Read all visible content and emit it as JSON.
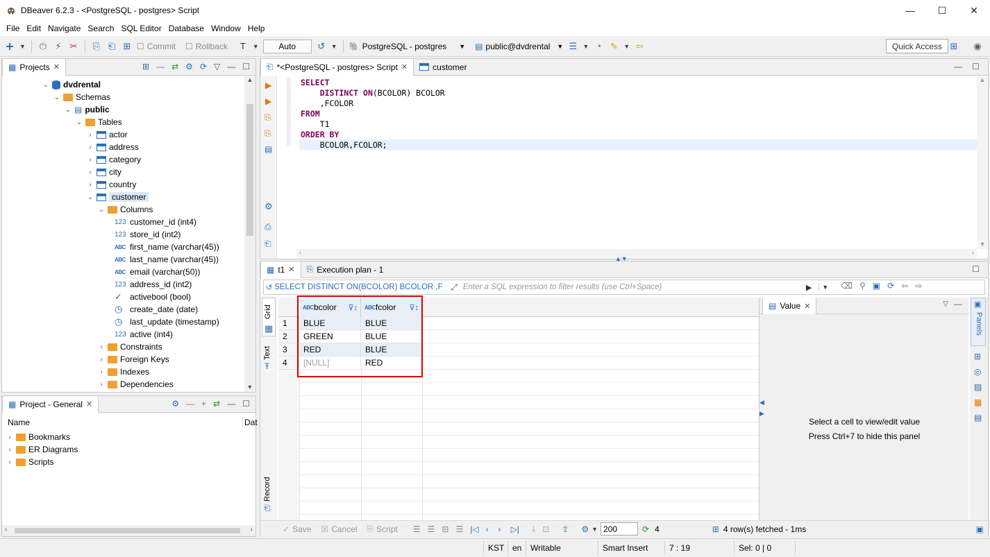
{
  "window": {
    "title": "DBeaver 6.2.3 - <PostgreSQL - postgres> Script",
    "minimize": "—",
    "maximize": "☐",
    "close": "✕"
  },
  "menu": [
    "File",
    "Edit",
    "Navigate",
    "Search",
    "SQL Editor",
    "Database",
    "Window",
    "Help"
  ],
  "toolbar": {
    "commit": "Commit",
    "rollback": "Rollback",
    "mode": "Auto",
    "connection": "PostgreSQL - postgres",
    "schema": "public@dvdrental",
    "quick_access": "Quick Access"
  },
  "projects_panel": {
    "tab": "Projects",
    "tree": [
      {
        "label": "dvdrental",
        "level": 0,
        "icon": "database-icon",
        "bold": true,
        "expanded": true
      },
      {
        "label": "Schemas",
        "level": 1,
        "icon": "folder-icon",
        "expanded": true
      },
      {
        "label": "public",
        "level": 2,
        "icon": "schema-icon",
        "bold": true,
        "expanded": true
      },
      {
        "label": "Tables",
        "level": 3,
        "icon": "folder-icon",
        "expanded": true
      },
      {
        "label": "actor",
        "level": 4,
        "icon": "table-icon"
      },
      {
        "label": "address",
        "level": 4,
        "icon": "table-icon"
      },
      {
        "label": "category",
        "level": 4,
        "icon": "table-icon"
      },
      {
        "label": "city",
        "level": 4,
        "icon": "table-icon"
      },
      {
        "label": "country",
        "level": 4,
        "icon": "table-icon"
      },
      {
        "label": "customer",
        "level": 4,
        "icon": "table-icon",
        "selected": true,
        "expanded": true
      },
      {
        "label": "Columns",
        "level": 5,
        "icon": "folder-icon",
        "expanded": true
      },
      {
        "label": "customer_id (int4)",
        "level": 6,
        "icon": "number-icon"
      },
      {
        "label": "store_id (int2)",
        "level": 6,
        "icon": "number-icon"
      },
      {
        "label": "first_name (varchar(45))",
        "level": 6,
        "icon": "text-icon"
      },
      {
        "label": "last_name (varchar(45))",
        "level": 6,
        "icon": "text-icon"
      },
      {
        "label": "email (varchar(50))",
        "level": 6,
        "icon": "text-icon"
      },
      {
        "label": "address_id (int2)",
        "level": 6,
        "icon": "number-icon"
      },
      {
        "label": "activebool (bool)",
        "level": 6,
        "icon": "check-icon"
      },
      {
        "label": "create_date (date)",
        "level": 6,
        "icon": "clock-icon"
      },
      {
        "label": "last_update (timestamp)",
        "level": 6,
        "icon": "clock-icon"
      },
      {
        "label": "active (int4)",
        "level": 6,
        "icon": "number-icon"
      },
      {
        "label": "Constraints",
        "level": 5,
        "icon": "folder-icon"
      },
      {
        "label": "Foreign Keys",
        "level": 5,
        "icon": "folder-icon"
      },
      {
        "label": "Indexes",
        "level": 5,
        "icon": "folder-icon"
      },
      {
        "label": "Dependencies",
        "level": 5,
        "icon": "folder-icon"
      }
    ]
  },
  "project_general": {
    "tab": "Project - General",
    "col_name": "Name",
    "col_date": "Dat",
    "items": [
      "Bookmarks",
      "ER Diagrams",
      "Scripts"
    ]
  },
  "editor": {
    "tab_script": "*<PostgreSQL - postgres> Script",
    "tab_customer": "customer",
    "code_lines": [
      [
        {
          "t": "SELECT",
          "k": 1
        }
      ],
      [
        {
          "t": "    ",
          "k": 0
        },
        {
          "t": "DISTINCT ON",
          "k": 1
        },
        {
          "t": "(BCOLOR) BCOLOR",
          "k": 0
        }
      ],
      [
        {
          "t": "    ,FCOLOR",
          "k": 0
        }
      ],
      [
        {
          "t": "FROM",
          "k": 1
        }
      ],
      [
        {
          "t": "    T1",
          "k": 0
        }
      ],
      [
        {
          "t": "ORDER BY",
          "k": 1
        }
      ],
      [
        {
          "t": "    BCOLOR,FCOLOR;",
          "k": 0
        }
      ]
    ]
  },
  "results": {
    "tab_t1": "t1",
    "tab_plan": "Execution plan - 1",
    "filter_query": "SELECT DISTINCT ON(BCOLOR) BCOLOR ,F",
    "filter_placeholder": "Enter a SQL expression to filter results (use Ctrl+Space)",
    "side_grid": "Grid",
    "side_text": "Text",
    "side_record": "Record",
    "columns": [
      "bcolor",
      "fcolor"
    ],
    "rows": [
      {
        "n": "1",
        "bcolor": "BLUE",
        "fcolor": "BLUE"
      },
      {
        "n": "2",
        "bcolor": "GREEN",
        "fcolor": "BLUE"
      },
      {
        "n": "3",
        "bcolor": "RED",
        "fcolor": "BLUE"
      },
      {
        "n": "4",
        "bcolor": "[NULL]",
        "fcolor": "RED"
      }
    ],
    "value_panel": {
      "tab": "Value",
      "line1": "Select a cell to view/edit value",
      "line2": "Press Ctrl+7 to hide this panel"
    },
    "panels_label": "Panels",
    "bottom": {
      "save": "Save",
      "cancel": "Cancel",
      "script": "Script",
      "fetch_size": "200",
      "row_count": "4",
      "fetched": "4 row(s) fetched - 1ms"
    }
  },
  "status": {
    "tz": "KST",
    "lang": "en",
    "mode": "Writable",
    "insert": "Smart Insert",
    "pos": "7 : 19",
    "sel": "Sel: 0 | 0"
  },
  "colors": {
    "accent": "#2c6fb7",
    "keyword": "#7f0055",
    "highlight_box": "#e00000",
    "selection": "#dbe8f5"
  }
}
